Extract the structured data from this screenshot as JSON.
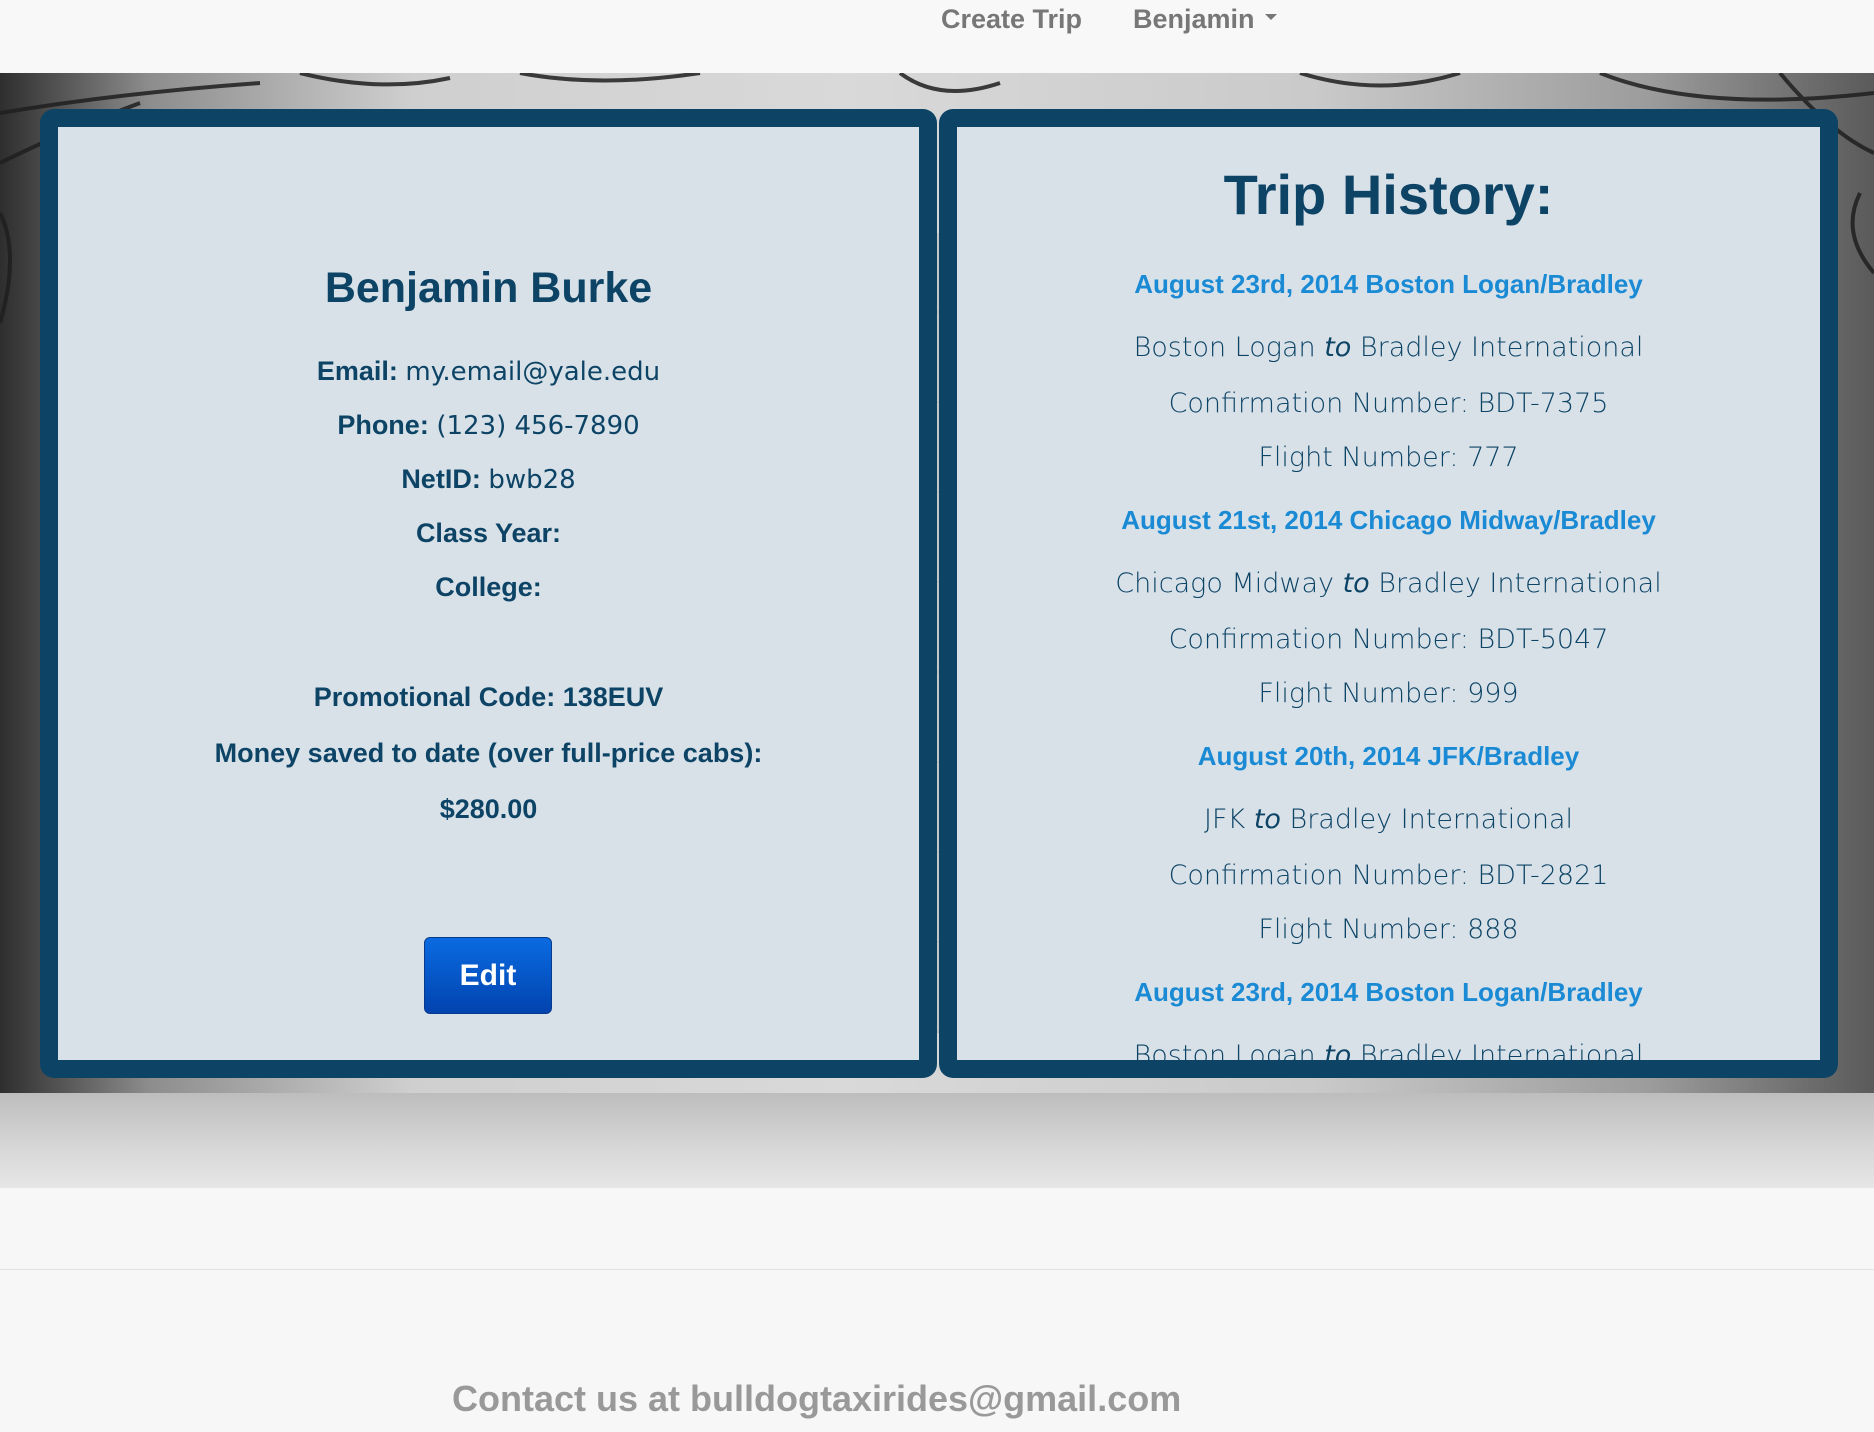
{
  "nav": {
    "create_trip": "Create Trip",
    "user_menu": "Benjamin"
  },
  "profile": {
    "name": "Benjamin Burke",
    "email_label": "Email:",
    "email": "my.email@yale.edu",
    "phone_label": "Phone:",
    "phone": "(123) 456-7890",
    "netid_label": "NetID:",
    "netid": "bwb28",
    "class_year_label": "Class Year:",
    "college_label": "College:",
    "promo_code": "Promotional Code: 138EUV",
    "money_saved_label": "Money saved to date (over full-price cabs):",
    "money_saved": "$280.00",
    "edit_label": "Edit"
  },
  "trip_history": {
    "title": "Trip History:",
    "to_word": "to",
    "trips": [
      {
        "heading": "August 23rd, 2014 Boston Logan/Bradley",
        "from": "Boston Logan",
        "dest": "Bradley International",
        "confirmation": "Confirmation Number: BDT-7375",
        "flight": "Flight Number: 777"
      },
      {
        "heading": "August 21st, 2014 Chicago Midway/Bradley",
        "from": "Chicago Midway",
        "dest": "Bradley International",
        "confirmation": "Confirmation Number: BDT-5047",
        "flight": "Flight Number: 999"
      },
      {
        "heading": "August 20th, 2014 JFK/Bradley",
        "from": "JFK",
        "dest": "Bradley International",
        "confirmation": "Confirmation Number: BDT-2821",
        "flight": "Flight Number: 888"
      },
      {
        "heading": "August 23rd, 2014 Boston Logan/Bradley",
        "from": "Boston Logan",
        "dest": "Bradley International"
      }
    ]
  },
  "footer": {
    "contact": "Contact us at bulldogtaxirides@gmail.com"
  },
  "colors": {
    "brand_dark": "#0d4466",
    "link": "#1a8ad4",
    "button": "#0243b0"
  }
}
